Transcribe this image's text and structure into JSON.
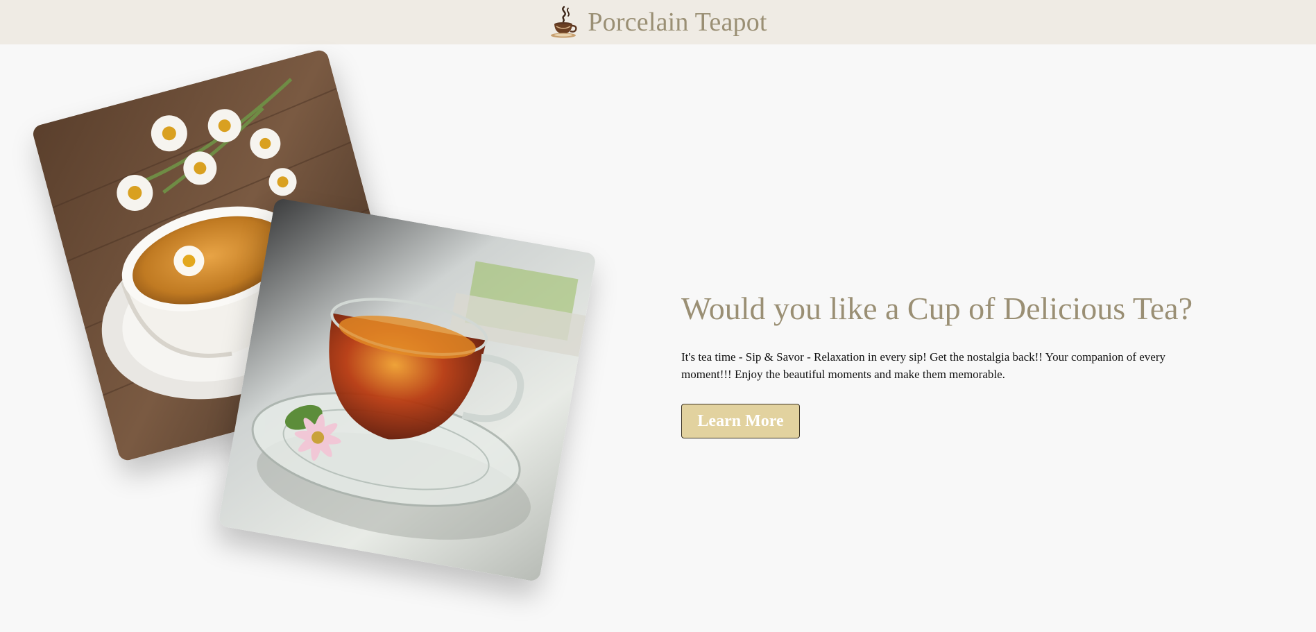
{
  "header": {
    "title": "Porcelain Teapot",
    "logo_icon": "teacup-steam-icon"
  },
  "hero": {
    "heading": "Would you like a Cup of Delicious Tea?",
    "text": "It's tea time - Sip & Savor - Relaxation in every sip! Get the nostalgia back!! Your companion of every moment!!! Enjoy the beautiful moments and make them memorable.",
    "button_label": "Learn More"
  },
  "images": {
    "back": "chamomile-tea-cup-photo",
    "front": "glass-black-tea-cup-photo"
  },
  "colors": {
    "header_bg": "#efebe4",
    "page_bg": "#f8f8f8",
    "accent_text": "#9a8f74",
    "button_bg": "#e2d29f",
    "button_border": "#3a3223"
  }
}
